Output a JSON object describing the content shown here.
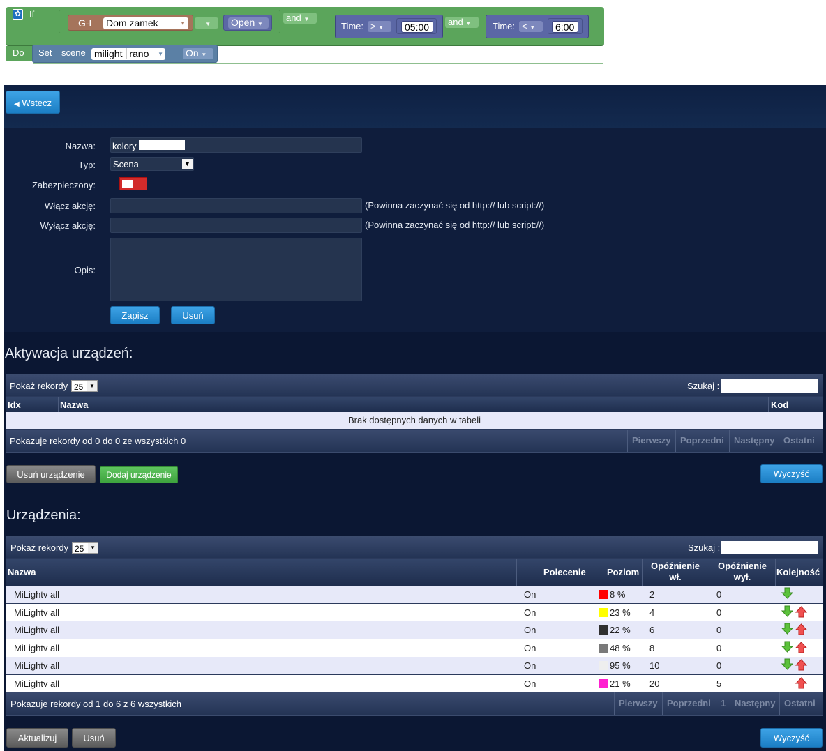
{
  "blockly": {
    "if_label": "If",
    "do_label": "Do",
    "device_prefix": "G-L",
    "device_name": "Dom zamek",
    "eq_op": "=",
    "state_value": "Open",
    "and1": "and",
    "and2": "and",
    "time1_label": "Time:",
    "time1_op": ">",
    "time1_value": "05:00",
    "time2_label": "Time:",
    "time2_op": "<",
    "time2_value": "6:00",
    "set_label": "Set",
    "scene_label": "scene",
    "scene_name_1": "milight",
    "scene_name_2": "rano",
    "set_eq": "=",
    "set_value": "On"
  },
  "nav": {
    "back_label": "Wstecz"
  },
  "form": {
    "name_label": "Nazwa:",
    "name_value": "kolory",
    "type_label": "Typ:",
    "type_value": "Scena",
    "protected_label": "Zabezpieczony:",
    "on_action_label": "Włącz akcję:",
    "off_action_label": "Wyłącz akcję:",
    "action_hint": "(Powinna zaczynać się od http:// lub script://)",
    "desc_label": "Opis:",
    "save_label": "Zapisz",
    "delete_label": "Usuń"
  },
  "activation": {
    "title": "Aktywacja urządzeń:",
    "show_label": "Pokaż rekordy",
    "show_value": "25",
    "search_label": "Szukaj :",
    "columns": [
      "Idx",
      "Nazwa",
      "Kod"
    ],
    "empty_text": "Brak dostępnych danych w tabeli",
    "info": "Pokazuje rekordy od 0 do 0 ze wszystkich 0",
    "pager": [
      "Pierwszy",
      "Poprzedni",
      "Następny",
      "Ostatni"
    ],
    "remove_device_label": "Usuń urządzenie",
    "add_device_label": "Dodaj urządzenie",
    "clear_label": "Wyczyść"
  },
  "devices": {
    "title": "Urządzenia:",
    "show_label": "Pokaż rekordy",
    "show_value": "25",
    "search_label": "Szukaj :",
    "columns": {
      "name": "Nazwa",
      "command": "Polecenie",
      "level": "Poziom",
      "delay_on_1": "Opóźnienie",
      "delay_on_2": "wł.",
      "delay_off_1": "Opóźnienie",
      "delay_off_2": "wył.",
      "order": "Kolejność"
    },
    "rows": [
      {
        "name": "MiLightv all",
        "command": "On",
        "color": "#ff0000",
        "level": "8 %",
        "delay_on": "2",
        "delay_off": "0",
        "down": true,
        "up": false
      },
      {
        "name": "MiLightv all",
        "command": "On",
        "color": "#ffff00",
        "level": "23 %",
        "delay_on": "4",
        "delay_off": "0",
        "down": true,
        "up": true
      },
      {
        "name": "MiLightv all",
        "command": "On",
        "color": "#303030",
        "level": "22 %",
        "delay_on": "6",
        "delay_off": "0",
        "down": true,
        "up": true
      },
      {
        "name": "MiLightv all",
        "command": "On",
        "color": "#7a7a7a",
        "level": "48 %",
        "delay_on": "8",
        "delay_off": "0",
        "down": true,
        "up": true
      },
      {
        "name": "MiLightv all",
        "command": "On",
        "color": "#eeeeee",
        "level": "95 %",
        "delay_on": "10",
        "delay_off": "0",
        "down": true,
        "up": true
      },
      {
        "name": "MiLightv all",
        "command": "On",
        "color": "#ff1fd0",
        "level": "21 %",
        "delay_on": "20",
        "delay_off": "5",
        "down": false,
        "up": true
      }
    ],
    "info": "Pokazuje rekordy od 1 do 6 z 6 wszystkich",
    "pager": [
      "Pierwszy",
      "Poprzedni",
      "1",
      "Następny",
      "Ostatni"
    ],
    "update_label": "Aktualizuj",
    "delete_label": "Usuń",
    "clear_label": "Wyczyść"
  }
}
